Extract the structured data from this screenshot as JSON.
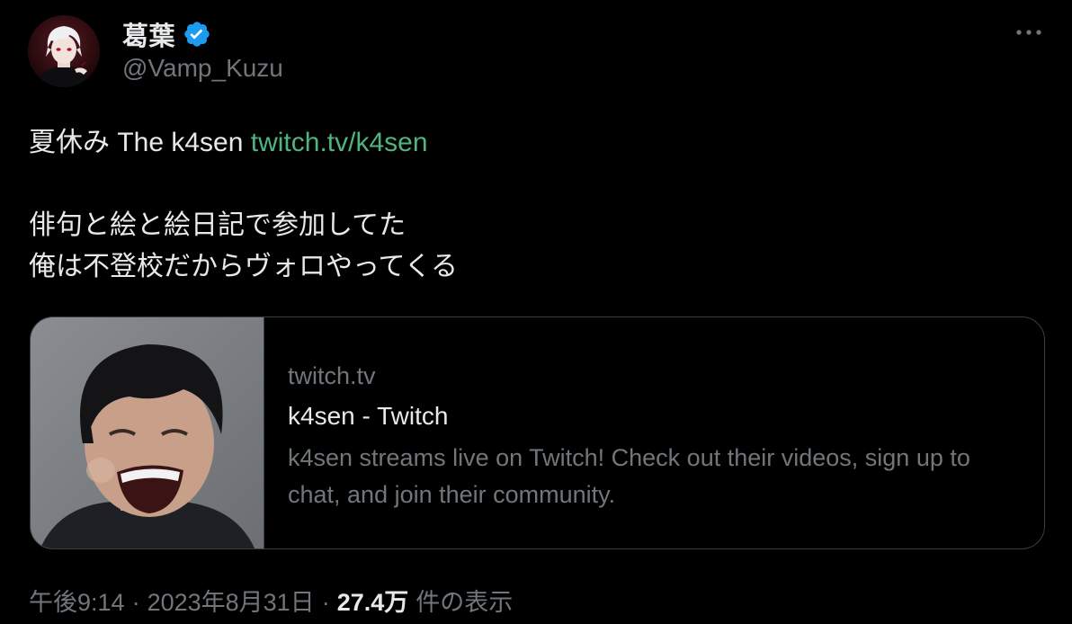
{
  "author": {
    "display_name": "葛葉",
    "handle": "@Vamp_Kuzu",
    "verified": true,
    "avatar_icon": "avatar-vampire-character"
  },
  "more_icon": "ellipsis-icon",
  "tweet": {
    "text_prefix": "夏休み The k4sen ",
    "link_text": "twitch.tv/k4sen",
    "line2": "俳句と絵と絵日記で参加してた",
    "line3": "俺は不登校だからヴォロやってくる"
  },
  "card": {
    "domain": "twitch.tv",
    "title": "k4sen - Twitch",
    "description": "k4sen streams live on Twitch! Check out their videos, sign up to chat, and join their community.",
    "thumbnail_icon": "laughing-man-photo"
  },
  "meta": {
    "time": "午後9:14",
    "date": "2023年8月31日",
    "views_count": "27.4万",
    "views_label": "件の表示",
    "separator": "·"
  },
  "colors": {
    "background": "#000000",
    "text": "#e7e9ea",
    "secondary": "#71767b",
    "link": "#50b47f",
    "verified_badge": "#1d9bf0",
    "card_border": "#3a3d41"
  }
}
